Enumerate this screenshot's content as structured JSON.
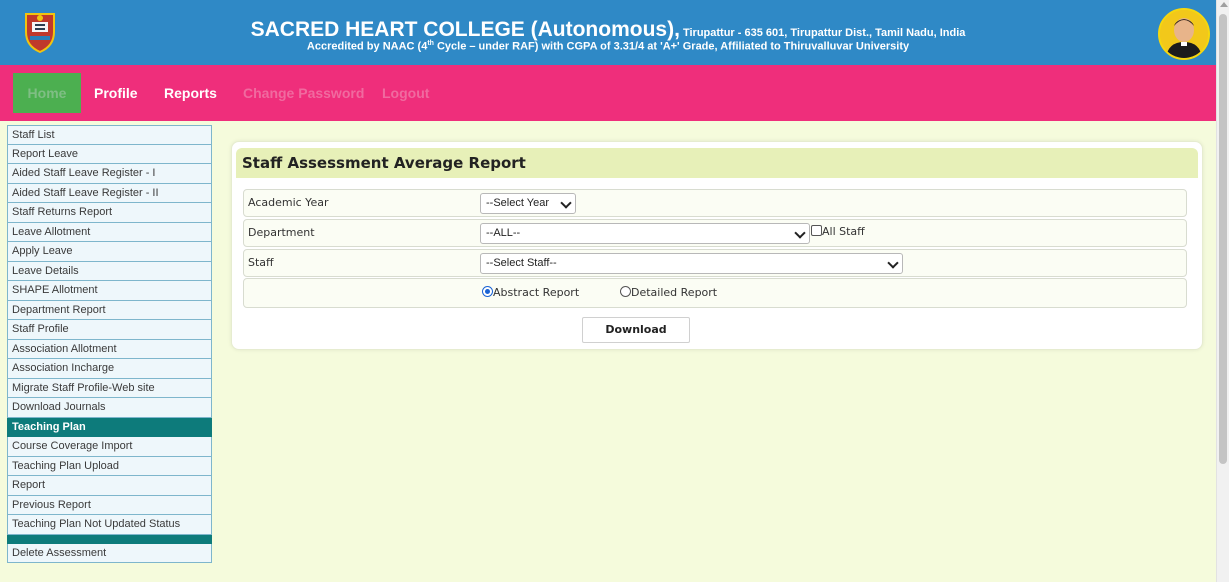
{
  "header": {
    "title_main": "SACRED HEART COLLEGE (Autonomous),",
    "title_small": " Tirupattur - 635 601, Tirupattur Dist., Tamil Nadu, India",
    "sub_before": "Accredited by NAAC (4",
    "sub_sup": "th",
    "sub_after": " Cycle – under RAF) with CGPA of 3.31/4 at 'A+' Grade, Affiliated to Thiruvalluvar University",
    "logo_icon": "college-crest",
    "avatar_icon": "profile-avatar"
  },
  "nav": {
    "home": "Home",
    "profile": "Profile",
    "reports": "Reports",
    "change_password": "Change Password",
    "logout": "Logout"
  },
  "sidebar": {
    "items": [
      "Staff List",
      "Report Leave",
      "Aided Staff Leave Register - I",
      "Aided Staff Leave Register - II",
      "Staff Returns Report",
      "Leave Allotment",
      "Apply Leave",
      "Leave Details",
      "SHAPE Allotment",
      "Department Report",
      "Staff Profile",
      "Association Allotment",
      "Association Incharge",
      "Migrate Staff Profile-Web site",
      "Download Journals"
    ],
    "section_teaching": "Teaching Plan",
    "teaching_items": [
      "Course Coverage Import",
      "Teaching Plan Upload",
      "Report",
      "Previous Report",
      "Teaching Plan Not Updated Status"
    ],
    "last_item": "Delete Assessment"
  },
  "panel": {
    "title": "Staff Assessment Average Report",
    "academic_year_label": "Academic Year",
    "academic_year_value": "--Select Year",
    "department_label": "Department",
    "department_value": "--ALL--",
    "all_staff_label": "All Staff",
    "staff_label": "Staff",
    "staff_value": "--Select Staff--",
    "radio_abstract": "Abstract Report",
    "radio_detailed": "Detailed Report",
    "download_label": "Download"
  },
  "colors": {
    "header_bg": "#2f89c6",
    "nav_bg": "#ef2e7b",
    "home_bg": "#4caf50",
    "section_bg": "#0d7b7b",
    "page_bg": "#f5fbdc"
  }
}
